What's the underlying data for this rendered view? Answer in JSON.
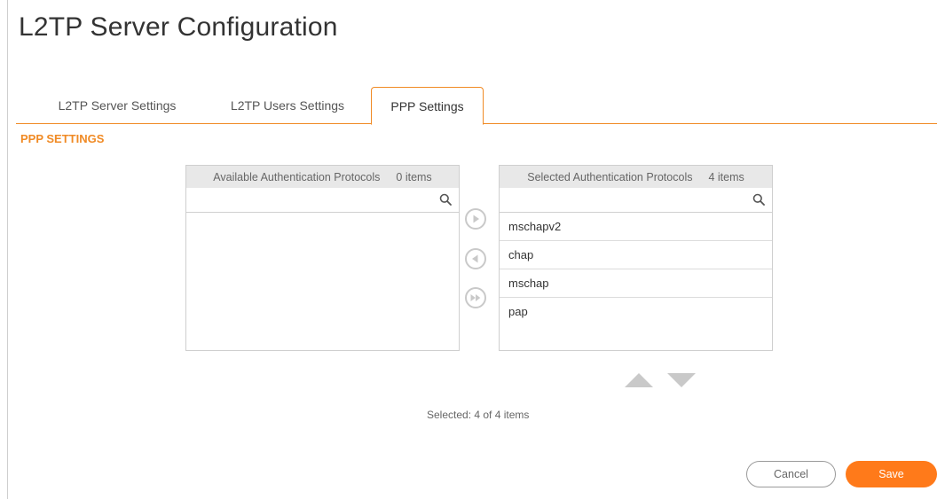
{
  "page": {
    "title": "L2TP Server Configuration"
  },
  "tabs": [
    {
      "label": "L2TP Server Settings"
    },
    {
      "label": "L2TP Users Settings"
    },
    {
      "label": "PPP Settings"
    }
  ],
  "section": {
    "title": "PPP SETTINGS"
  },
  "available": {
    "header": "Available Authentication Protocols",
    "count": "0 items",
    "search_value": ""
  },
  "selected": {
    "header": "Selected Authentication Protocols",
    "count": "4 items",
    "search_value": "",
    "items": [
      "mschapv2",
      "chap",
      "mschap",
      "pap"
    ]
  },
  "status": {
    "selected_text": "Selected: 4 of 4 items"
  },
  "buttons": {
    "cancel": "Cancel",
    "save": "Save"
  },
  "colors": {
    "accent": "#f08a24",
    "save_button": "#ff7a1a",
    "icon_gray": "#c9c9c9"
  },
  "icons": {
    "search": "search-icon",
    "move_right": "play-right-icon",
    "move_left": "play-left-icon",
    "move_all_right": "fast-forward-icon",
    "move_up": "triangle-up-icon",
    "move_down": "triangle-down-icon"
  }
}
